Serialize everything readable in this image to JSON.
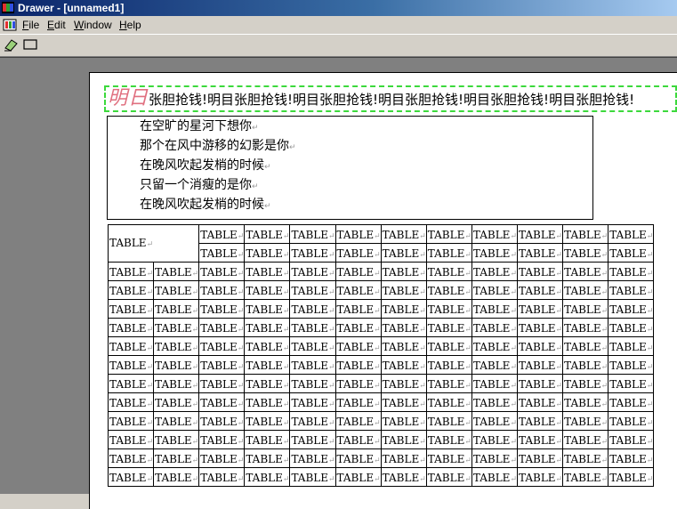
{
  "window": {
    "title": "Drawer - [unnamed1]"
  },
  "menu": {
    "items": [
      {
        "accel": "F",
        "rest": "ile"
      },
      {
        "accel": "E",
        "rest": "dit"
      },
      {
        "accel": "W",
        "rest": "indow"
      },
      {
        "accel": "H",
        "rest": "elp"
      }
    ]
  },
  "toolbar": {
    "tools": [
      "eraser-icon",
      "rectangle-icon"
    ]
  },
  "document": {
    "banner_big": "明日",
    "banner_text": "张胆抢钱!明目张胆抢钱!明目张胆抢钱!明目张胆抢钱!明目张胆抢钱!明目张胆抢钱!",
    "poem": [
      "在空旷的星河下想你",
      "那个在风中游移的幻影是你",
      "在晚风吹起发梢的时候",
      "只留一个消瘦的是你",
      "在晚风吹起发梢的时候"
    ],
    "paragraph_mark": "↵",
    "table": {
      "corner": "TABLE",
      "cell": "TABLE"
    }
  }
}
